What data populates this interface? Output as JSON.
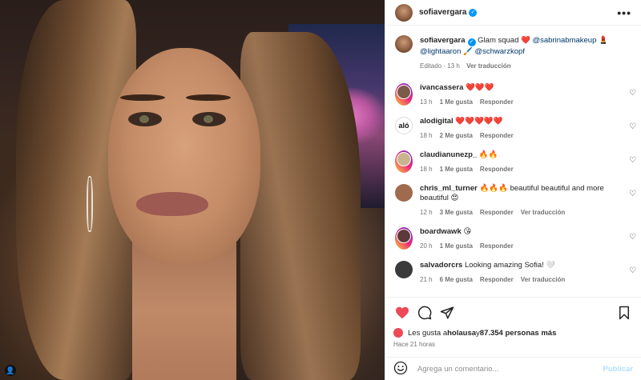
{
  "header": {
    "username": "sofiavergara",
    "more": "•••"
  },
  "caption": {
    "username": "sofiavergara",
    "text": " Glam squad ❤️ ",
    "mention1": "@sabrinabmakeup",
    "emoji1": " 💄",
    "mention2": "@lightaaron",
    "emoji2": " 🖌️ ",
    "mention3": "@schwarzkopf",
    "edited": "Editado",
    "time": "13 h",
    "translate": "Ver traducción"
  },
  "comments": [
    {
      "user": "ivancassera",
      "text": "❤️❤️❤️",
      "time": "13 h",
      "likes": "1 Me gusta",
      "reply": "Responder",
      "translate": "",
      "avatar_color": "#7a5a48"
    },
    {
      "user": "alodigital",
      "text": "❤️❤️❤️❤️❤️",
      "time": "18 h",
      "likes": "2 Me gusta",
      "reply": "Responder",
      "translate": "",
      "avatar_color": "#ffffff",
      "avatar_text": "aló"
    },
    {
      "user": "claudianunezp_",
      "text": "🔥🔥",
      "time": "18 h",
      "likes": "1 Me gusta",
      "reply": "Responder",
      "translate": "",
      "avatar_color": "#c9b48e"
    },
    {
      "user": "chris_ml_turner",
      "text": "🔥🔥🔥 beautiful beautiful and more beautiful 😍",
      "time": "12 h",
      "likes": "3 Me gusta",
      "reply": "Responder",
      "translate": "Ver traducción",
      "avatar_color": "#a06a4e"
    },
    {
      "user": "boardwawk",
      "text": "😘",
      "time": "20 h",
      "likes": "1 Me gusta",
      "reply": "Responder",
      "translate": "",
      "avatar_color": "#5a3a3a"
    },
    {
      "user": "salvadorcrs",
      "text": "Looking amazing Sofia! 🤍",
      "time": "21 h",
      "likes": "6 Me gusta",
      "reply": "Responder",
      "translate": "Ver traducción",
      "avatar_color": "#3a3a3a"
    }
  ],
  "likes_line": {
    "prefix": "Les gusta a ",
    "user": "holausa",
    "mid": " y ",
    "count": "87.354 personas más"
  },
  "posted": "Hace 21 horas",
  "add_comment": {
    "placeholder": "Agrega un comentario...",
    "publish": "Publicar"
  },
  "colors": {
    "like_red": "#ed4956",
    "link_blue": "#00376b",
    "verified_blue": "#0095f6",
    "publish_disabled": "#b2dffc"
  }
}
